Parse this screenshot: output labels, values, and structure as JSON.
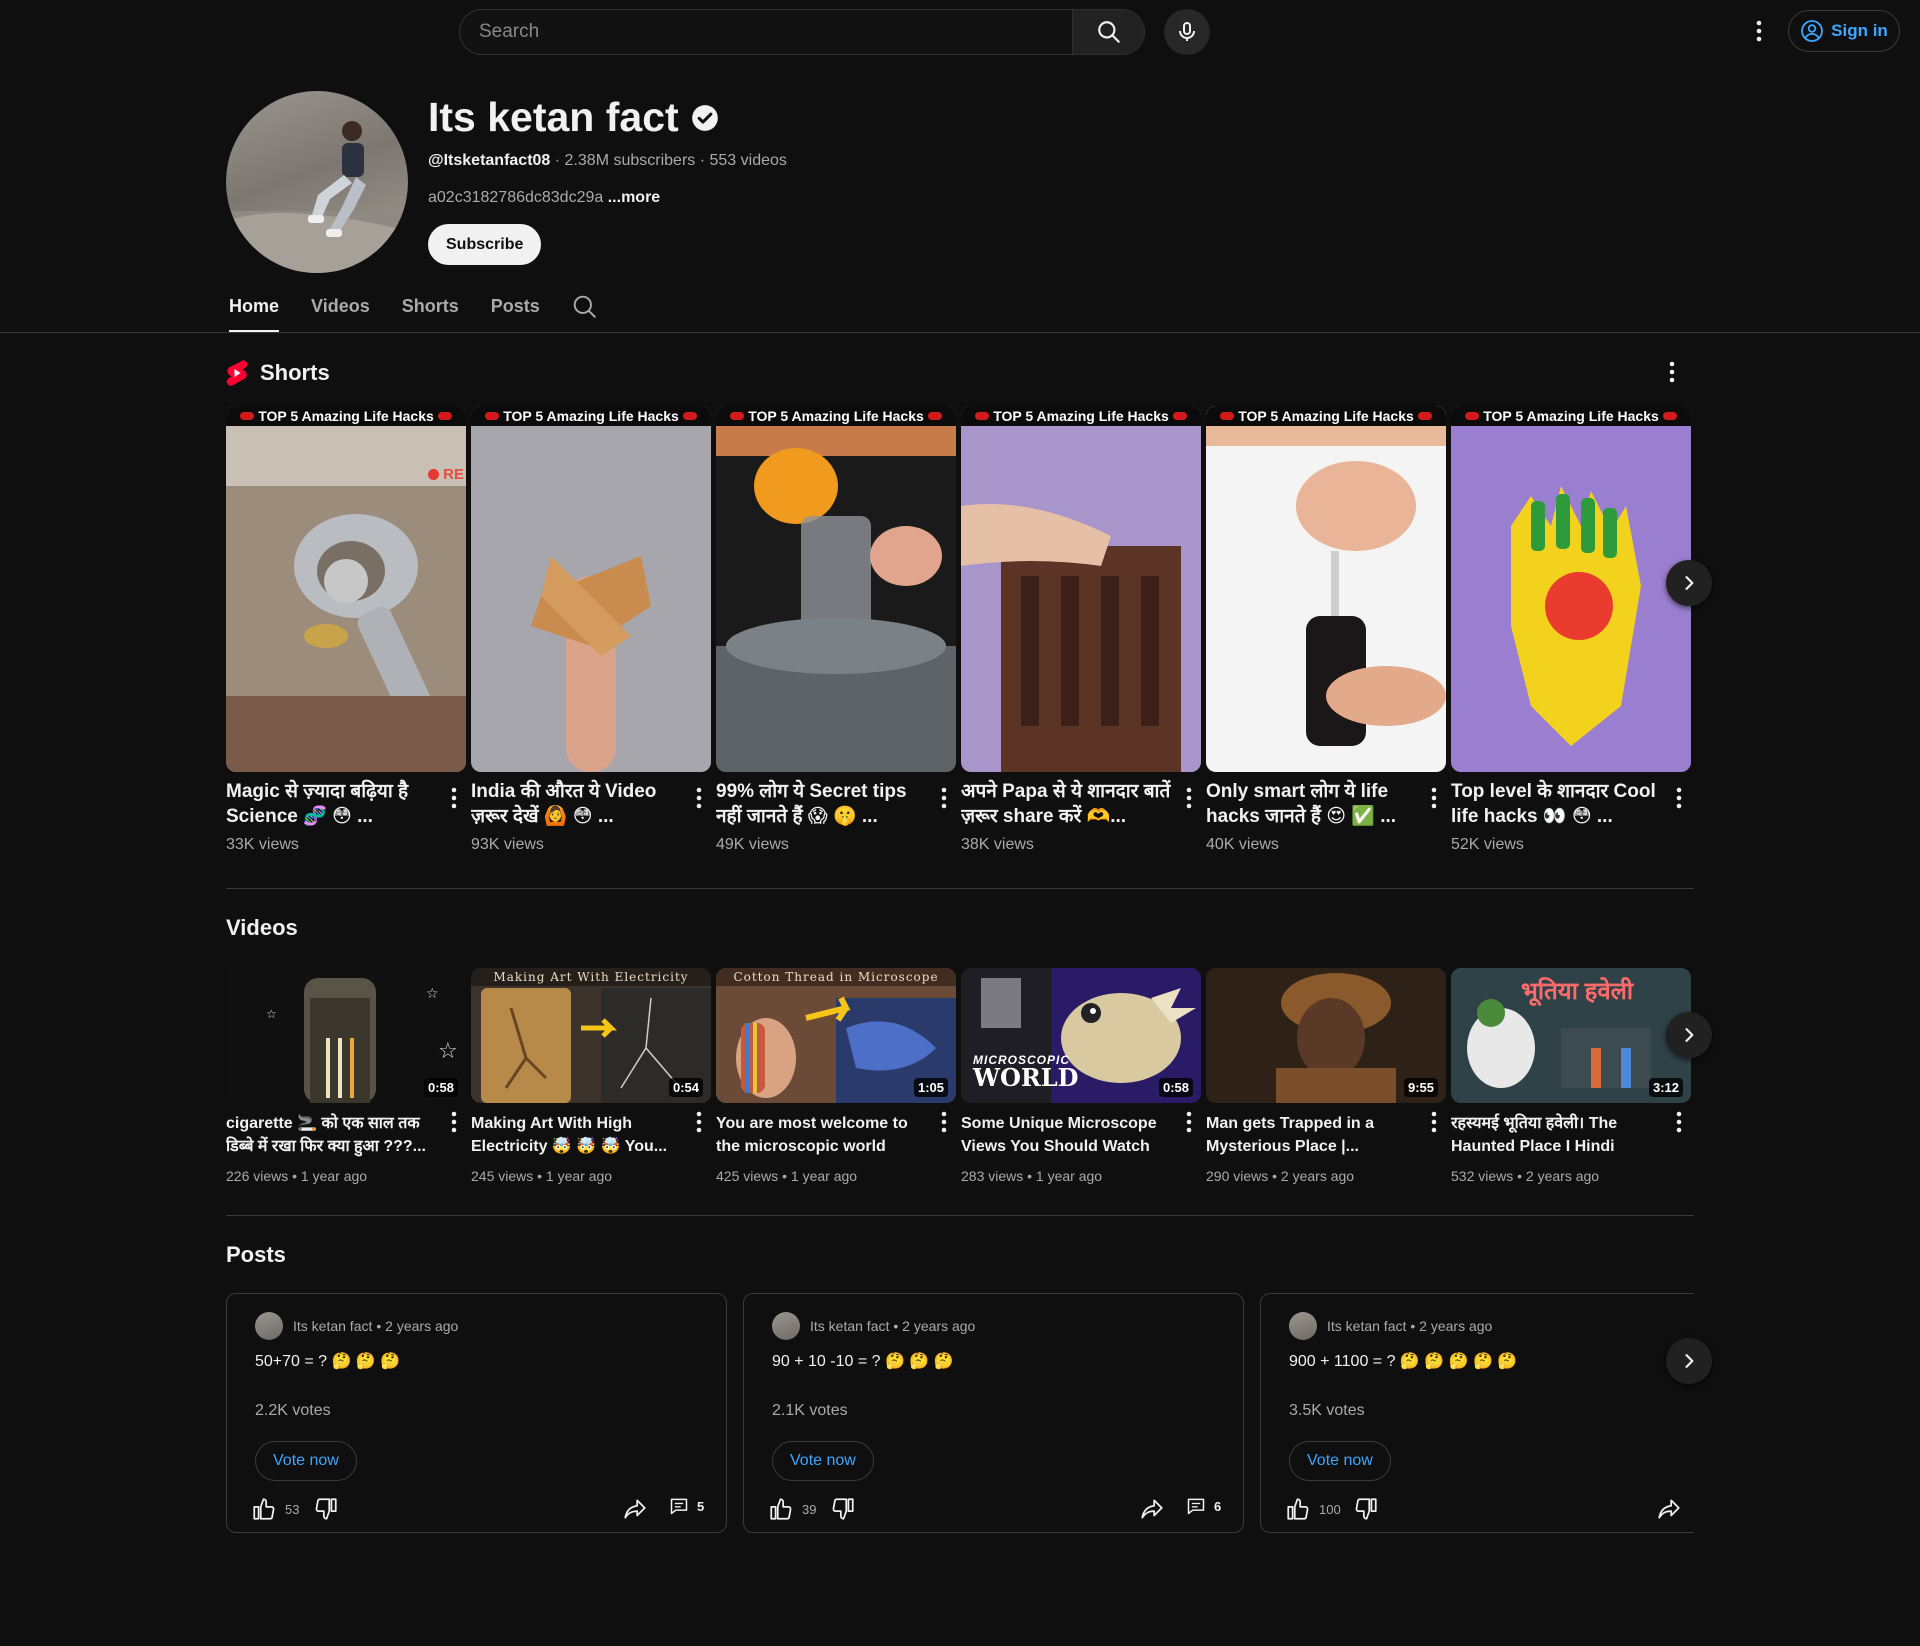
{
  "search": {
    "placeholder": "Search"
  },
  "topbar": {
    "sign_in_label": "Sign in"
  },
  "channel": {
    "name": "Its ketan fact",
    "handle": "@Itsketanfact08",
    "stats": "· 2.38M subscribers · 553 videos",
    "description": "a02c3182786dc83dc29a",
    "more_label": "...more",
    "subscribe_label": "Subscribe"
  },
  "tabs": [
    {
      "label": "Home"
    },
    {
      "label": "Videos"
    },
    {
      "label": "Shorts"
    },
    {
      "label": "Posts"
    }
  ],
  "shorts": {
    "title": "Shorts",
    "items": [
      {
        "banner": "TOP 5 Amazing Life Hacks",
        "title": "Magic से ज़्यादा बढ़िया है Science 🧬 😳 ...",
        "views": "33K views",
        "overlay": "RE"
      },
      {
        "banner": "TOP 5 Amazing Life Hacks",
        "title": "India की औरत ये Video ज़रूर देखें 🙆 😳 ...",
        "views": "93K views"
      },
      {
        "banner": "TOP 5 Amazing Life Hacks",
        "title": "99% लोग ये Secret tips नहीं जानते हैं 😱 🤫 ...",
        "views": "49K views"
      },
      {
        "banner": "TOP 5 Amazing Life Hacks",
        "title": "अपने Papa से ये शानदार बातें ज़रूर share करें 🫶...",
        "views": "38K views"
      },
      {
        "banner": "TOP 5 Amazing Life Hacks",
        "title": "Only smart लोग ये life hacks जानते हैं 😍 ✅ ...",
        "views": "40K views"
      },
      {
        "banner": "TOP 5 Amazing Life Hacks",
        "title": "Top level के शानदार Cool life hacks 👀 😳 ...",
        "views": "52K views"
      }
    ]
  },
  "videos": {
    "title": "Videos",
    "items": [
      {
        "title": "cigarette 🚬 को एक साल तक डिब्बे में रखा फिर क्या हुआ ???...",
        "meta": "226 views • 1 year ago",
        "duration": "0:58",
        "caption": "",
        "color": "#151515"
      },
      {
        "title": "Making Art With High Electricity 🤯 🤯 🤯 You...",
        "meta": "245 views • 1 year ago",
        "duration": "0:54",
        "caption": "Making Art With Electricity",
        "color": "#5b4a36"
      },
      {
        "title": "You are most welcome to the microscopic world",
        "meta": "425 views • 1 year ago",
        "duration": "1:05",
        "caption": "Cotton Thread in Microscope",
        "color": "#4a3628"
      },
      {
        "title": "Some Unique Microscope Views You Should Watch thi...",
        "meta": "283 views • 1 year ago",
        "duration": "0:58",
        "caption": "",
        "badge_line1": "MICROSCOPIC",
        "badge_line2": "WORLD",
        "color": "#2b1a5e"
      },
      {
        "title": "Man gets Trapped in a Mysterious Place |...",
        "meta": "290 views • 2 years ago",
        "duration": "9:55",
        "caption": "",
        "color": "#3a2a1e"
      },
      {
        "title": "रहस्यमई भूतिया हवेली। The Haunted Place I Hindi story...",
        "meta": "532 views • 2 years ago",
        "duration": "3:12",
        "caption": "",
        "overlay": "भूतिया हवेली",
        "color": "#2a3e44"
      }
    ]
  },
  "posts": {
    "title": "Posts",
    "items": [
      {
        "author": "Its ketan fact",
        "time": "• 2 years ago",
        "question": "50+70 = ? 🤔 🤔 🤔",
        "votes": "2.2K votes",
        "vote_label": "Vote now",
        "likes": "53",
        "comments": "5"
      },
      {
        "author": "Its ketan fact",
        "time": "• 2 years ago",
        "question": "90 + 10 -10 = ? 🤔 🤔 🤔",
        "votes": "2.1K votes",
        "vote_label": "Vote now",
        "likes": "39",
        "comments": "6"
      },
      {
        "author": "Its ketan fact",
        "time": "• 2 years ago",
        "question": "900 + 1100 = ? 🤔 🤔 🤔 🤔 🤔",
        "votes": "3.5K votes",
        "vote_label": "Vote now",
        "likes": "100",
        "comments": ""
      }
    ]
  },
  "colors": {
    "accent": "#3ea6ff",
    "shorts_red": "#ff0033",
    "background": "#0f0f0f"
  }
}
